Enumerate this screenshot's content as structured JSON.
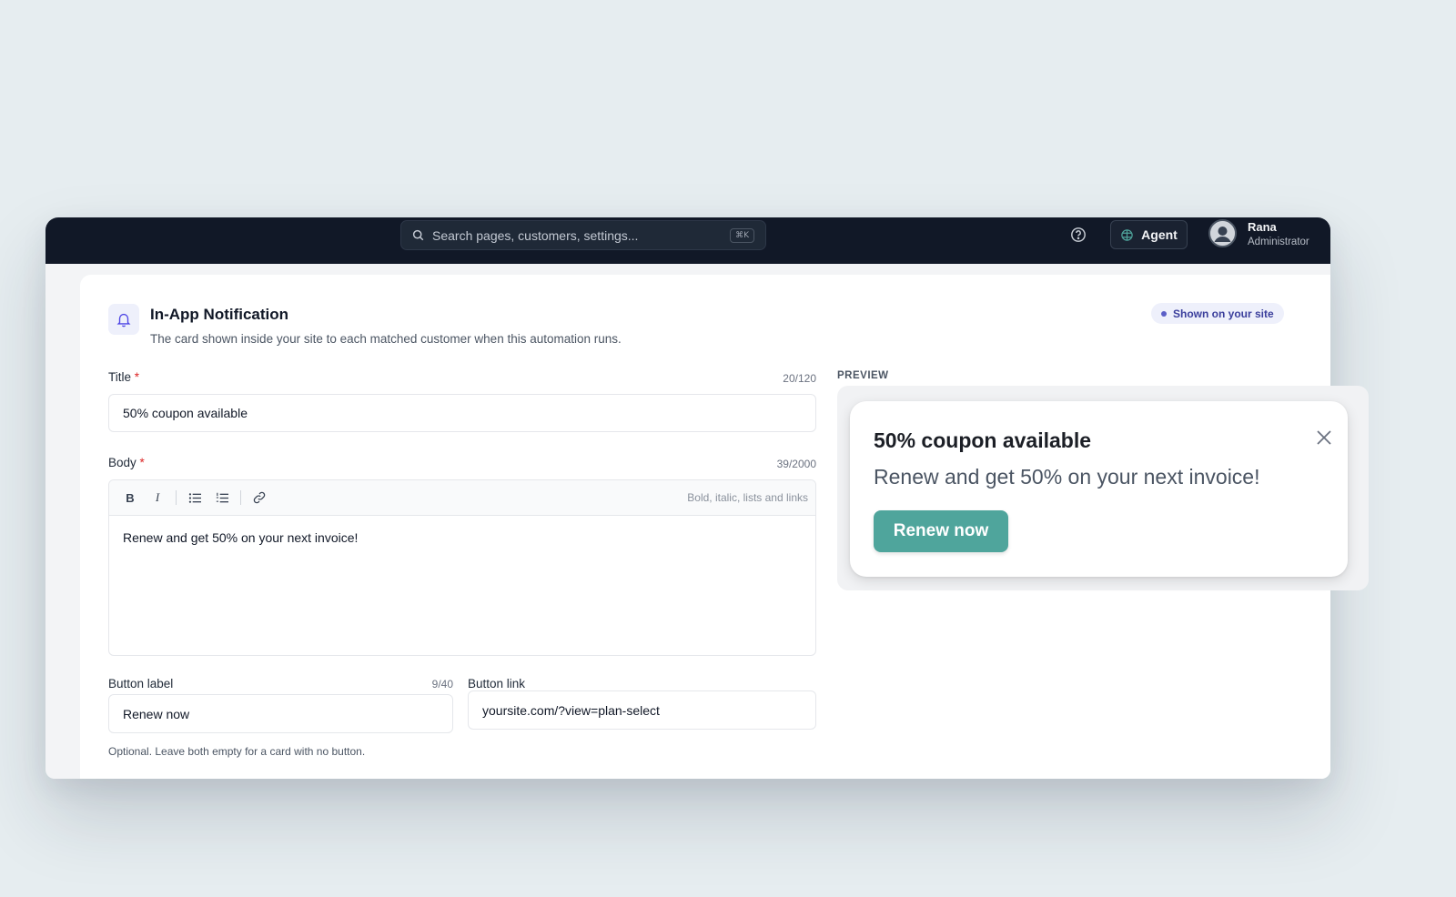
{
  "topbar": {
    "search_placeholder": "Search pages, customers, settings...",
    "search_shortcut": "⌘K",
    "agent_label": "Agent",
    "user": {
      "name": "Rana",
      "role": "Administrator"
    }
  },
  "card": {
    "title": "In-App Notification",
    "subtitle": "The card shown inside your site to each matched customer when this automation runs.",
    "badge": "Shown on your site"
  },
  "form": {
    "title_label": "Title",
    "required_mark": "*",
    "title_counter": "20/120",
    "title_value": "50% coupon available",
    "body_label": "Body",
    "body_counter": "39/2000",
    "toolbar": {
      "bold": "B",
      "italic": "I",
      "hint": "Bold, italic, lists and links"
    },
    "body_value": "Renew and get 50% on your next invoice!",
    "button_label_label": "Button label",
    "button_label_counter": "9/40",
    "button_label_value": "Renew now",
    "button_link_label": "Button link",
    "button_link_value": "yoursite.com/?view=plan-select",
    "helper": "Optional. Leave both empty for a card with no button."
  },
  "preview": {
    "label": "PREVIEW",
    "title": "50% coupon available",
    "body": "Renew and get 50% on your next invoice!",
    "button": "Renew now"
  },
  "colors": {
    "topbar": "#111827",
    "accent": "#5b5fc7",
    "required": "#dc2626",
    "preview_button": "#4fa59c"
  }
}
